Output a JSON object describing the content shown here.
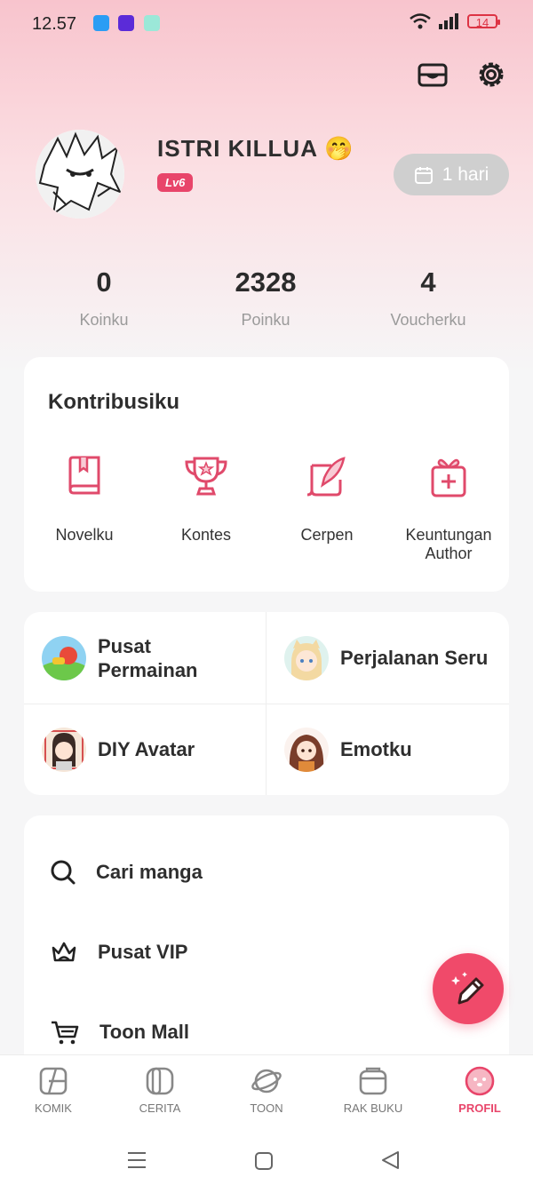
{
  "status_bar": {
    "time": "12.57",
    "battery": "14"
  },
  "profile": {
    "username": "ISTRI KILLUA",
    "username_emoji": "🤭",
    "level": "Lv6",
    "checkin_label": "1 hari"
  },
  "stats": [
    {
      "value": "0",
      "label": "Koinku"
    },
    {
      "value": "2328",
      "label": "Poinku"
    },
    {
      "value": "4",
      "label": "Voucherku"
    }
  ],
  "contributions": {
    "title": "Kontribusiku",
    "items": [
      {
        "label": "Novelku",
        "icon": "book-icon"
      },
      {
        "label": "Kontes",
        "icon": "trophy-icon"
      },
      {
        "label": "Cerpen",
        "icon": "quill-icon"
      },
      {
        "label": "Keuntungan Author",
        "icon": "gift-icon"
      }
    ]
  },
  "features": [
    {
      "label": "Pusat Permainan",
      "icon": "game-center-icon"
    },
    {
      "label": "Perjalanan Seru",
      "icon": "adventure-icon"
    },
    {
      "label": "DIY Avatar",
      "icon": "diy-avatar-icon"
    },
    {
      "label": "Emotku",
      "icon": "emoticon-icon"
    }
  ],
  "menu": [
    {
      "label": "Cari manga",
      "icon": "search-icon"
    },
    {
      "label": "Pusat VIP",
      "icon": "crown-icon"
    },
    {
      "label": "Toon Mall",
      "icon": "cart-icon"
    }
  ],
  "bottom_nav": [
    {
      "label": "KOMIK",
      "icon": "comic-icon"
    },
    {
      "label": "CERITA",
      "icon": "story-icon"
    },
    {
      "label": "TOON",
      "icon": "planet-icon"
    },
    {
      "label": "RAK BUKU",
      "icon": "bookshelf-icon"
    },
    {
      "label": "PROFIL",
      "icon": "profile-icon",
      "active": true
    }
  ],
  "colors": {
    "accent": "#e8456a",
    "fab": "#f04a6a",
    "icon_red": "#e04a6b"
  }
}
